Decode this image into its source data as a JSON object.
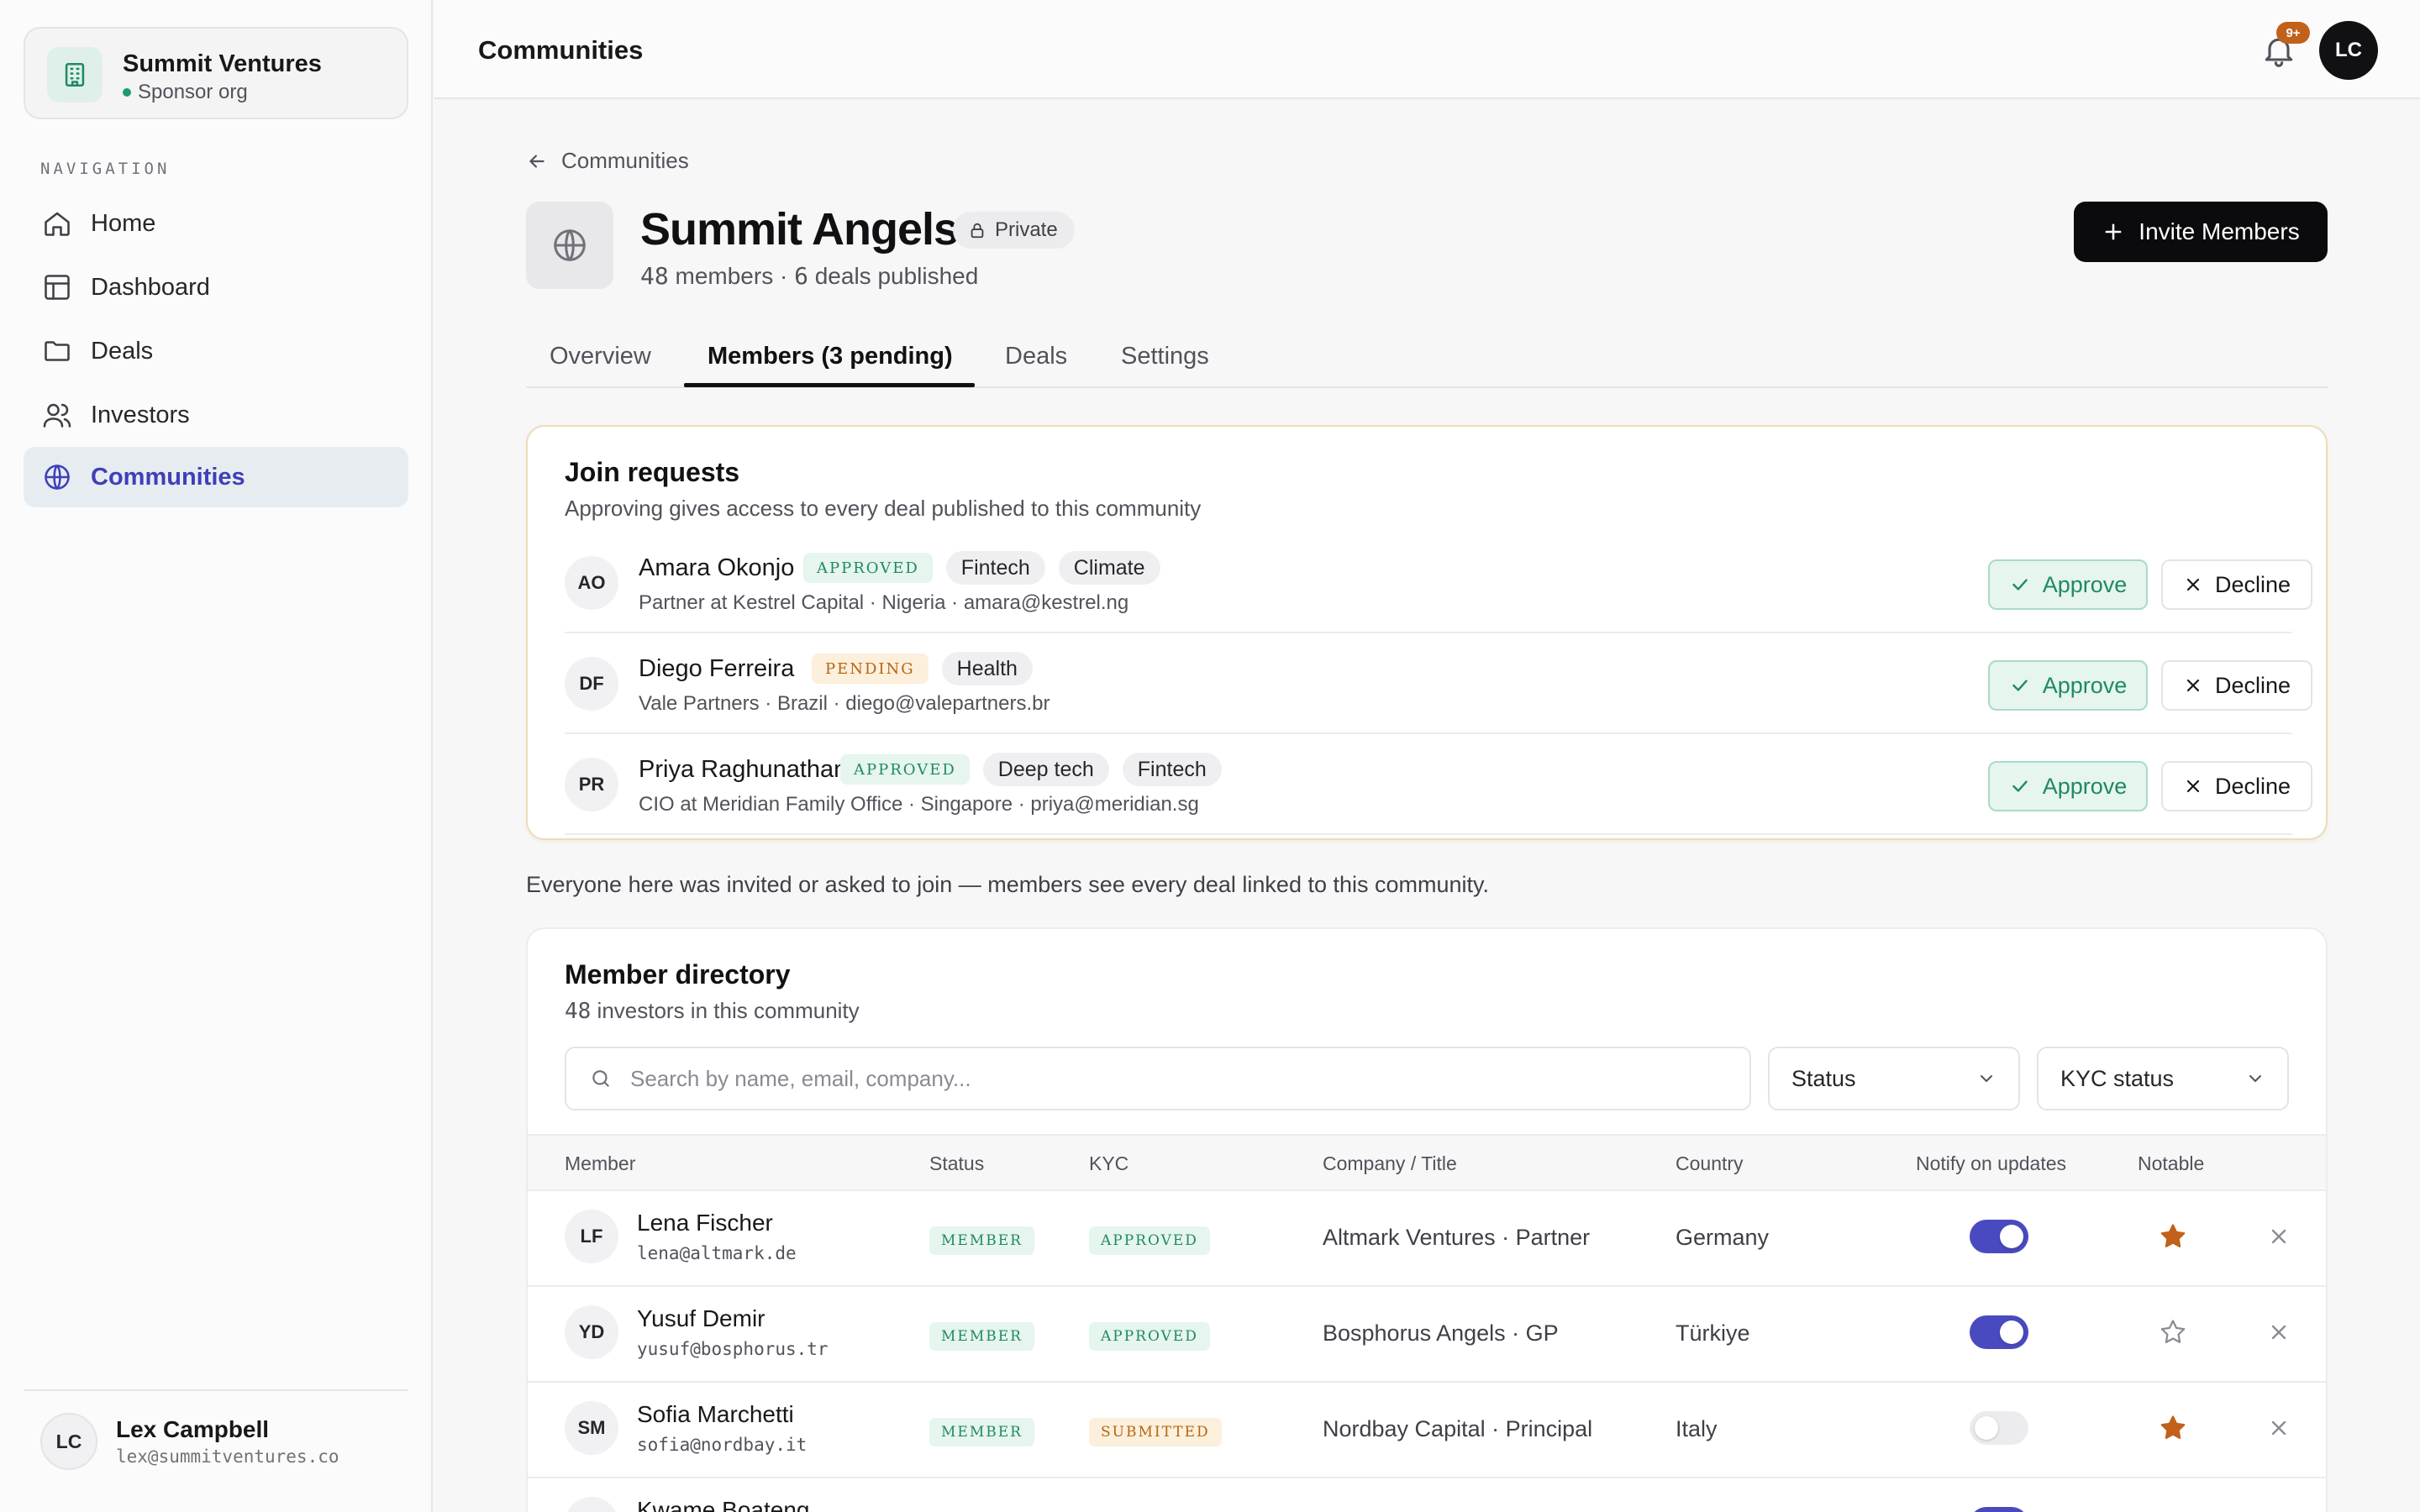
{
  "org": {
    "name": "Summit Ventures",
    "role": "Sponsor org"
  },
  "nav": {
    "heading": "NAVIGATION",
    "items": [
      {
        "label": "Home",
        "icon": "home-icon"
      },
      {
        "label": "Dashboard",
        "icon": "layout-icon"
      },
      {
        "label": "Deals",
        "icon": "folder-icon"
      },
      {
        "label": "Investors",
        "icon": "users-icon"
      },
      {
        "label": "Communities",
        "icon": "globe-icon",
        "active": true
      }
    ]
  },
  "user": {
    "initials": "LC",
    "name": "Lex Campbell",
    "email": "lex@summitventures.co"
  },
  "topbar": {
    "title": "Communities",
    "notif_badge": "9+",
    "avatar_initials": "LC"
  },
  "breadcrumb": {
    "label": "Communities"
  },
  "community": {
    "name": "Summit Angels",
    "visibility": "Private",
    "members_count": "48",
    "members_label": "members",
    "separator": "·",
    "deals_count": "6",
    "deals_label": "deals published"
  },
  "invite_button": "Invite Members",
  "tabs": [
    "Overview",
    "Members (3 pending)",
    "Deals",
    "Settings"
  ],
  "join_requests": {
    "title": "Join requests",
    "subtitle": "Approving gives access to every deal published to this community",
    "approve_label": "Approve",
    "decline_label": "Decline",
    "items": [
      {
        "initials": "AO",
        "name": "Amara Okonjo",
        "status": "APPROVED",
        "tags": [
          "Fintech",
          "Climate"
        ],
        "meta": "Partner at Kestrel Capital · Nigeria · amara@kestrel.ng"
      },
      {
        "initials": "DF",
        "name": "Diego Ferreira",
        "status": "PENDING",
        "tags": [
          "Health"
        ],
        "meta": "Vale Partners · Brazil · diego@valepartners.br"
      },
      {
        "initials": "PR",
        "name": "Priya Raghunathan",
        "status": "APPROVED",
        "tags": [
          "Deep tech",
          "Fintech"
        ],
        "meta": "CIO at Meridian Family Office · Singapore · priya@meridian.sg"
      }
    ]
  },
  "info_line": "Everyone here was invited or asked to join — members see every deal linked to this community.",
  "directory": {
    "title": "Member directory",
    "count": "48",
    "count_label": "investors in this community",
    "search_placeholder": "Search by name, email, company...",
    "filters": [
      "Status",
      "KYC status"
    ],
    "columns": [
      "Member",
      "Status",
      "KYC",
      "Company / Title",
      "Country",
      "Notify on updates",
      "Notable"
    ],
    "rows": [
      {
        "initials": "LF",
        "name": "Lena Fischer",
        "email": "lena@altmark.de",
        "status": "MEMBER",
        "kyc": "APPROVED",
        "company": "Altmark Ventures · Partner",
        "country": "Germany",
        "notify": true,
        "notable": true
      },
      {
        "initials": "YD",
        "name": "Yusuf Demir",
        "email": "yusuf@bosphorus.tr",
        "status": "MEMBER",
        "kyc": "APPROVED",
        "company": "Bosphorus Angels · GP",
        "country": "Türkiye",
        "notify": true,
        "notable": false
      },
      {
        "initials": "SM",
        "name": "Sofia Marchetti",
        "email": "sofia@nordbay.it",
        "status": "MEMBER",
        "kyc": "SUBMITTED",
        "company": "Nordbay Capital · Principal",
        "country": "Italy",
        "notify": false,
        "notable": true
      },
      {
        "initials": "KB",
        "name": "Kwame Boateng",
        "email": "",
        "status": "",
        "kyc": "",
        "company": "",
        "country": "",
        "notify": true,
        "notable": false
      }
    ]
  },
  "colors": {
    "accent": "#4a4ac0",
    "approved": "#1f8a61",
    "pending": "#b7650f",
    "star": "#c2611a"
  }
}
